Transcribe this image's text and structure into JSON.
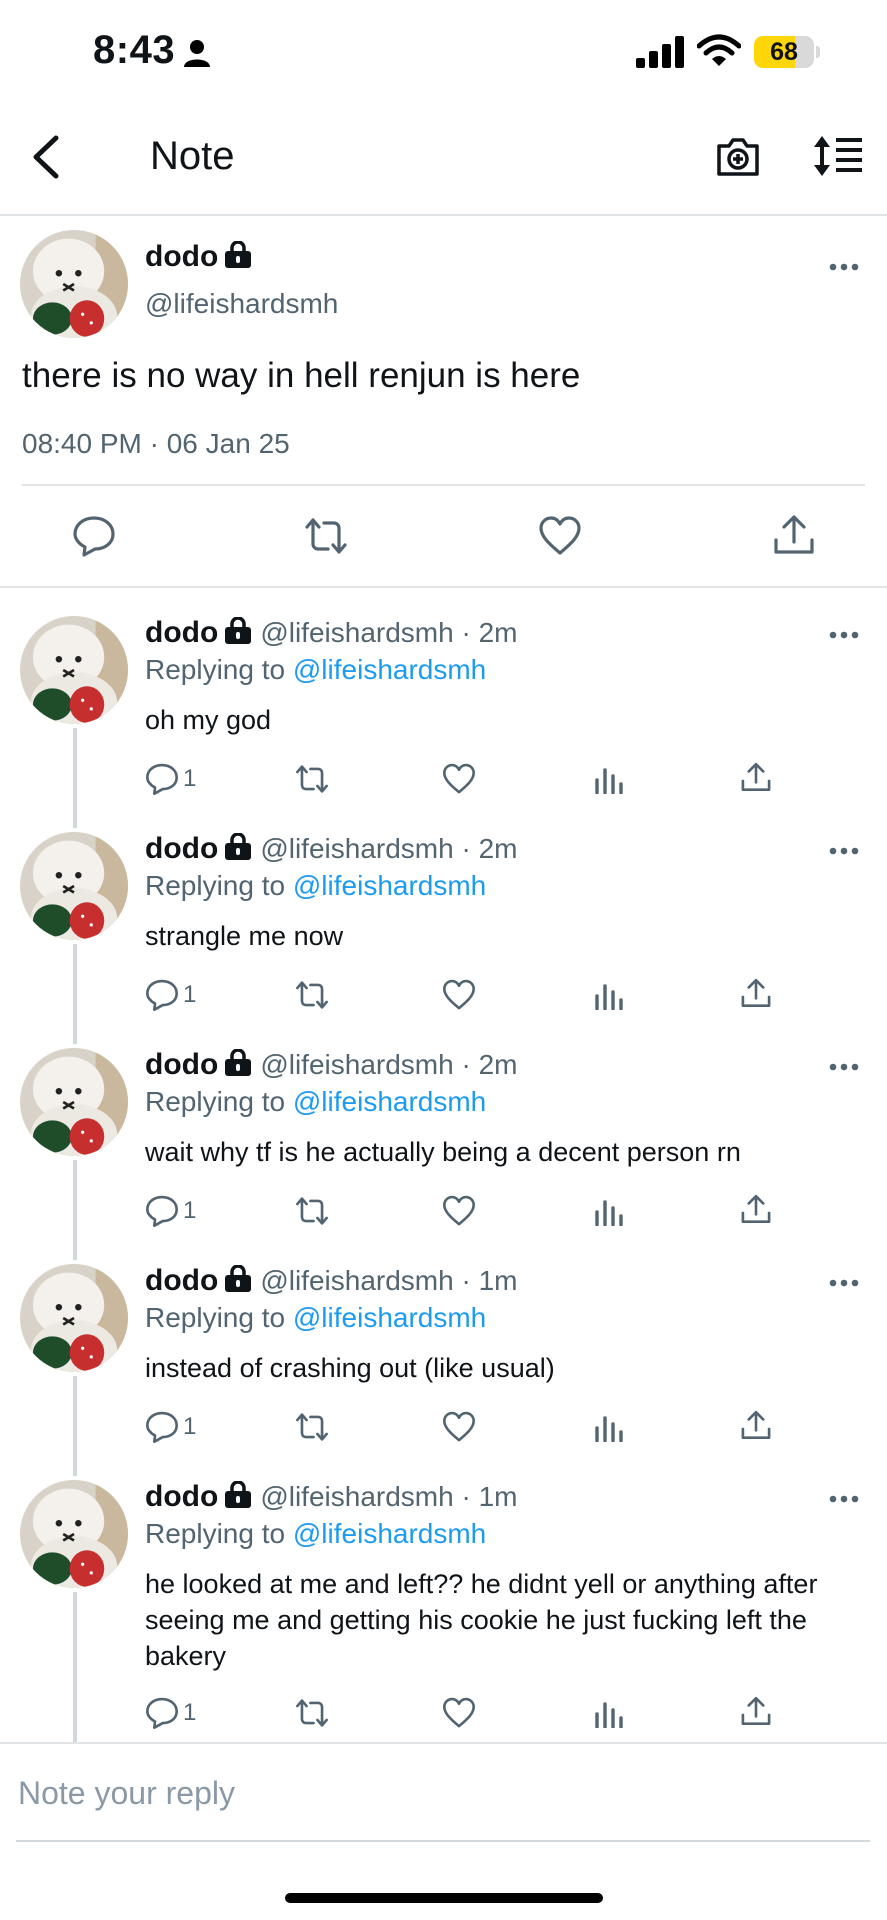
{
  "status_bar": {
    "time": "8:43",
    "battery_level": 68,
    "battery_text": "68",
    "icons": [
      "person-icon",
      "signal-icon",
      "wifi-icon",
      "battery-icon"
    ]
  },
  "nav": {
    "title": "Note",
    "icons": [
      "back-icon",
      "camera-icon",
      "sort-icon"
    ]
  },
  "main_tweet": {
    "name": "dodo",
    "handle": "@lifeishardsmh",
    "text": "there is no way in hell renjun is here",
    "timestamp": "08:40 PM · 06 Jan 25",
    "actions": [
      "comment-icon",
      "retweet-icon",
      "like-icon",
      "share-icon"
    ]
  },
  "replies": [
    {
      "name": "dodo",
      "handle": "@lifeishardsmh · 2m",
      "replying_prefix": "Replying to ",
      "replying_to": "@lifeishardsmh",
      "text": "oh my god",
      "comment_count": "1"
    },
    {
      "name": "dodo",
      "handle": "@lifeishardsmh · 2m",
      "replying_prefix": "Replying to ",
      "replying_to": "@lifeishardsmh",
      "text": "strangle me now",
      "comment_count": "1"
    },
    {
      "name": "dodo",
      "handle": "@lifeishardsmh · 2m",
      "replying_prefix": "Replying to ",
      "replying_to": "@lifeishardsmh",
      "text": "wait why tf is he actually being a decent person rn",
      "comment_count": "1"
    },
    {
      "name": "dodo",
      "handle": "@lifeishardsmh · 1m",
      "replying_prefix": "Replying to ",
      "replying_to": "@lifeishardsmh",
      "text": "instead of crashing out (like usual)",
      "comment_count": "1"
    },
    {
      "name": "dodo",
      "handle": "@lifeishardsmh · 1m",
      "replying_prefix": "Replying to ",
      "replying_to": "@lifeishardsmh",
      "text": "he looked at me and left?? he didnt yell or anything after seeing me and getting his cookie he just fucking left the bakery",
      "comment_count": "1"
    }
  ],
  "reply_bar": {
    "placeholder": "Note your reply"
  },
  "colors": {
    "accent": "#1d9bf0",
    "secondary_text": "#536471",
    "divider": "#e1e5e8",
    "battery": "#ffd60a"
  }
}
